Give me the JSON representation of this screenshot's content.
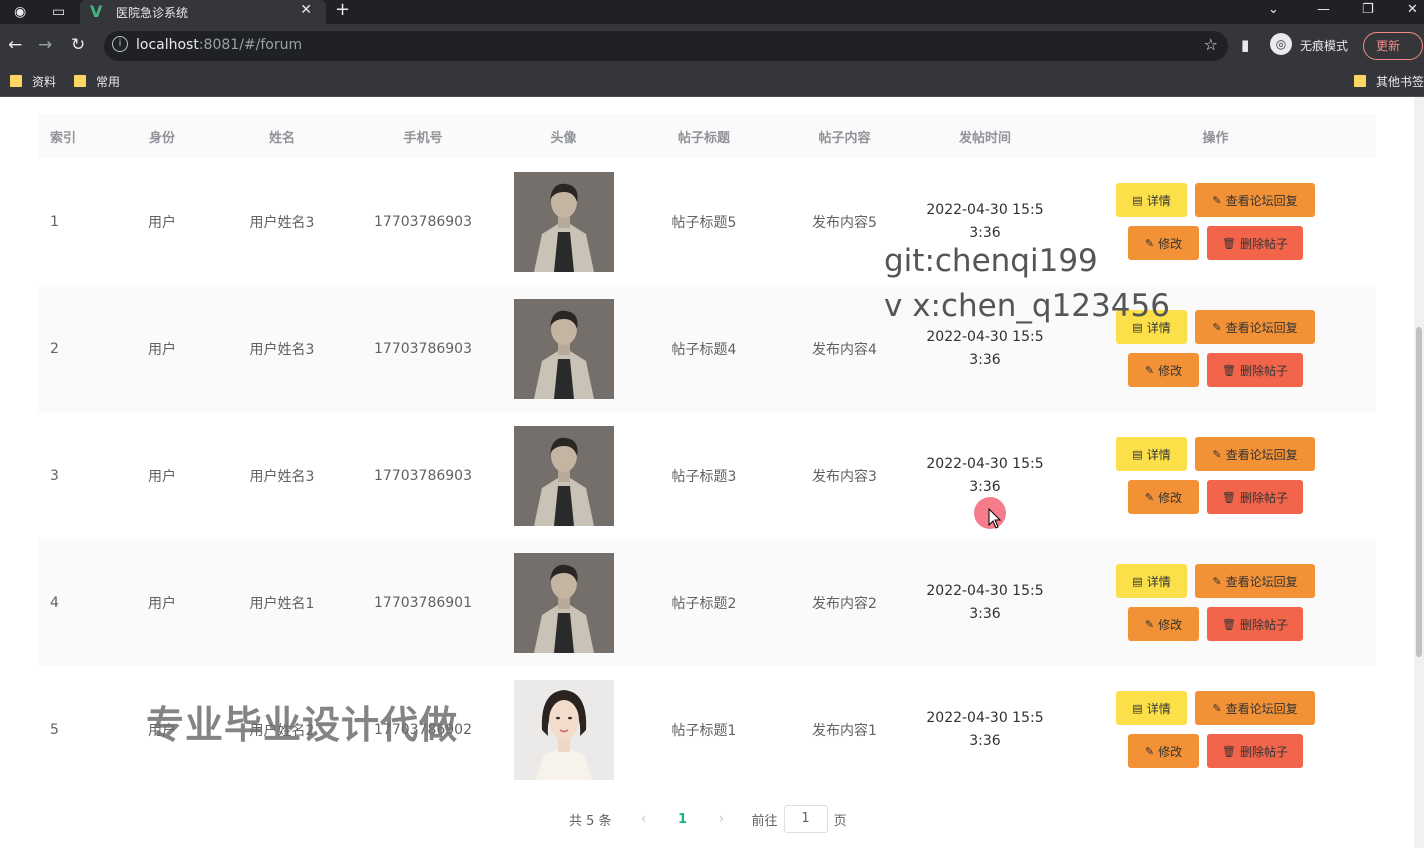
{
  "browser": {
    "tab_title": "医院急诊系统",
    "url_host": "localhost",
    "url_rest": ":8081/#/forum",
    "incognito_label": "无痕模式",
    "update_label": "更新",
    "bookmarks": [
      "资料",
      "常用"
    ],
    "other_bookmarks": "其他书签"
  },
  "table": {
    "headers": [
      "索引",
      "身份",
      "姓名",
      "手机号",
      "头像",
      "帖子标题",
      "帖子内容",
      "发帖时间",
      "操作"
    ],
    "rows": [
      {
        "index": "1",
        "role": "用户",
        "name": "用户姓名3",
        "phone": "17703786903",
        "avatar": "male-portrait",
        "title": "帖子标题5",
        "content": "发布内容5",
        "time1": "2022-04-30 15:5",
        "time2": "3:36"
      },
      {
        "index": "2",
        "role": "用户",
        "name": "用户姓名3",
        "phone": "17703786903",
        "avatar": "male-portrait",
        "title": "帖子标题4",
        "content": "发布内容4",
        "time1": "2022-04-30 15:5",
        "time2": "3:36"
      },
      {
        "index": "3",
        "role": "用户",
        "name": "用户姓名3",
        "phone": "17703786903",
        "avatar": "male-portrait",
        "title": "帖子标题3",
        "content": "发布内容3",
        "time1": "2022-04-30 15:5",
        "time2": "3:36"
      },
      {
        "index": "4",
        "role": "用户",
        "name": "用户姓名1",
        "phone": "17703786901",
        "avatar": "male-portrait",
        "title": "帖子标题2",
        "content": "发布内容2",
        "time1": "2022-04-30 15:5",
        "time2": "3:36"
      },
      {
        "index": "5",
        "role": "用户",
        "name": "用户姓名2",
        "phone": "17703786902",
        "avatar": "female-portrait",
        "title": "帖子标题1",
        "content": "发布内容1",
        "time1": "2022-04-30 15:5",
        "time2": "3:36"
      }
    ],
    "actions": {
      "detail": "详情",
      "view_replies": "查看论坛回复",
      "edit": "修改",
      "delete": "删除帖子"
    }
  },
  "pagination": {
    "total": "共 5 条",
    "current": "1",
    "goto_prefix": "前往",
    "goto_value": "1",
    "goto_suffix": "页"
  },
  "watermarks": {
    "git": "git:chenqi199",
    "vx": "v x:chen_q123456",
    "ad": "专业毕业设计代做"
  },
  "colors": {
    "detail": "#fbe04a",
    "reply": "#f39136",
    "edit": "#f39136",
    "delete": "#f2654a",
    "pager_active": "#14b879"
  }
}
